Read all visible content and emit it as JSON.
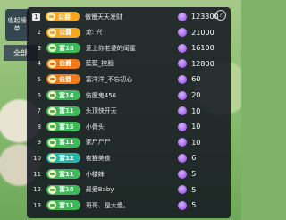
{
  "side_tab": {
    "label": "收起榜单"
  },
  "filter": {
    "label": "全部"
  },
  "help": {
    "label": "?"
  },
  "colors": {
    "gold": "#f5a623",
    "green": "#3fb85a",
    "orange": "#f07a1a",
    "teal": "#27b7a8",
    "score_purple": "#9b4ee8"
  },
  "leaderboard": [
    {
      "rank": "1",
      "badge": "公爵",
      "badge_color": "gold",
      "name": "傲慢天天发财",
      "score": "123300"
    },
    {
      "rank": "2",
      "badge": "公爵",
      "badge_color": "gold",
      "name": "龙: 兴",
      "score": "21000"
    },
    {
      "rank": "3",
      "badge": "富18",
      "badge_color": "green",
      "name": "爱上你老婆的闺蜜",
      "score": "16100"
    },
    {
      "rank": "4",
      "badge": "伯爵",
      "badge_color": "orange",
      "name": "藍藍_控股",
      "score": "12800"
    },
    {
      "rank": "5",
      "badge": "伯爵",
      "badge_color": "orange",
      "name": "富洋洋_不忘初心",
      "score": "60"
    },
    {
      "rank": "6",
      "badge": "富14",
      "badge_color": "green",
      "name": "伤魔鬼456",
      "score": "20"
    },
    {
      "rank": "7",
      "badge": "富11",
      "badge_color": "green",
      "name": "头顶快开天",
      "score": "10"
    },
    {
      "rank": "8",
      "badge": "富15",
      "badge_color": "green",
      "name": "小骨头",
      "score": "10"
    },
    {
      "rank": "9",
      "badge": "富11",
      "badge_color": "green",
      "name": "家尸尸尸",
      "score": "10"
    },
    {
      "rank": "10",
      "badge": "富12",
      "badge_color": "teal",
      "name": "夜猫美夜",
      "score": "6"
    },
    {
      "rank": "11",
      "badge": "富11",
      "badge_color": "green",
      "name": "小楼妹",
      "score": "5"
    },
    {
      "rank": "12",
      "badge": "富16",
      "badge_color": "green",
      "name": "最爱Baby.",
      "score": "5"
    },
    {
      "rank": "13",
      "badge": "富11",
      "badge_color": "green",
      "name": "哥哥、是大傻。",
      "score": "5"
    }
  ]
}
